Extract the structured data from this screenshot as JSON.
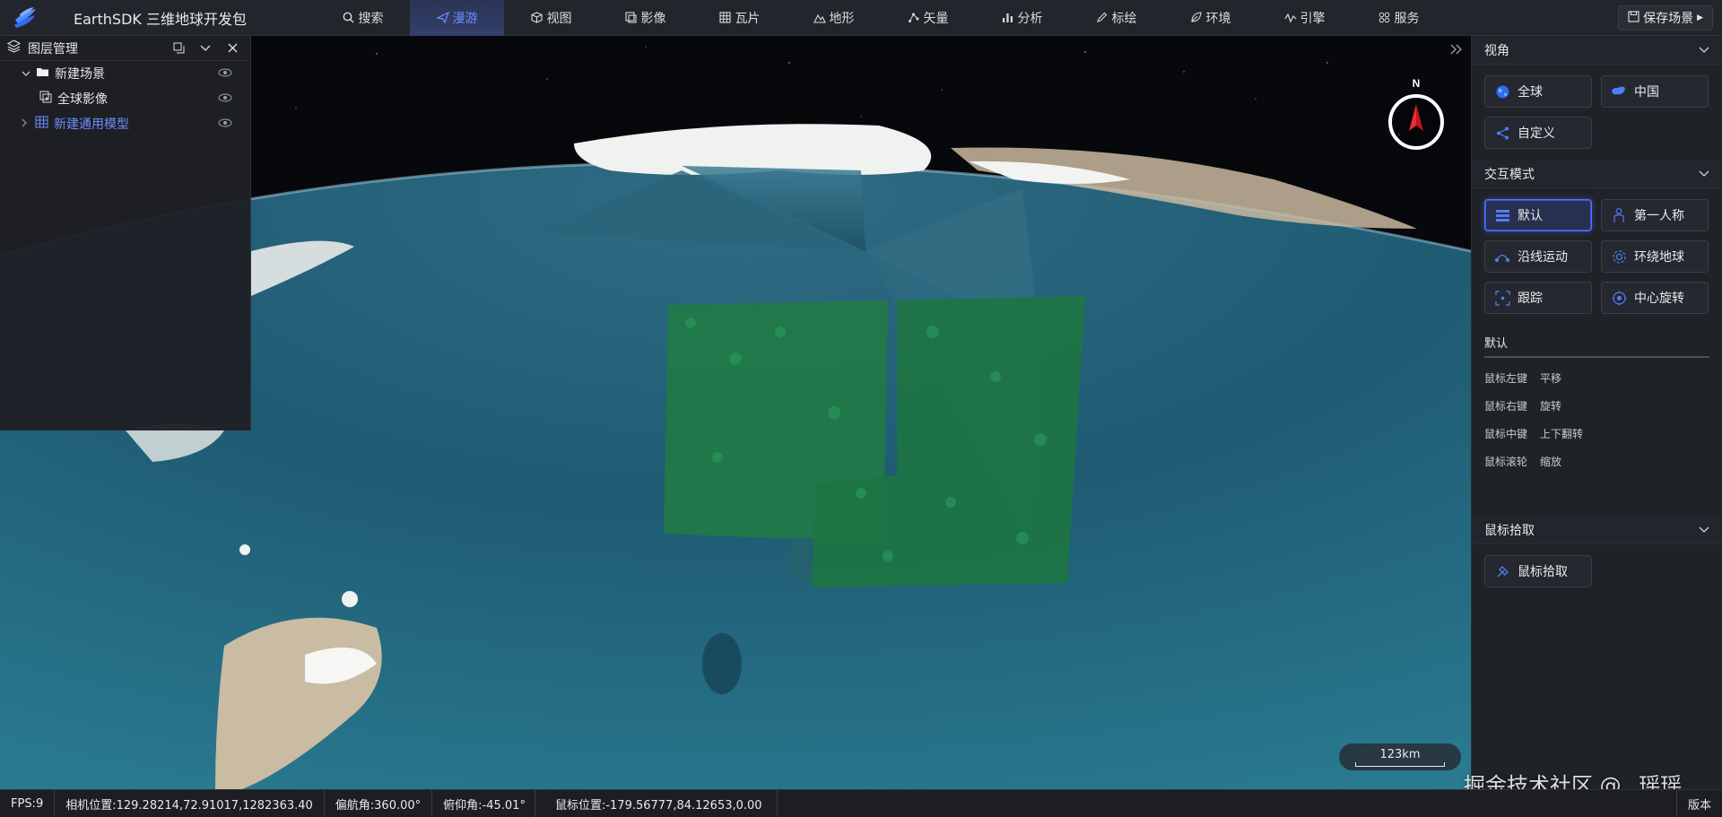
{
  "app": {
    "title": "EarthSDK 三维地球开发包"
  },
  "menu": [
    {
      "label": "搜索",
      "icon": "search-icon"
    },
    {
      "label": "漫游",
      "icon": "plane-icon",
      "active": true
    },
    {
      "label": "视图",
      "icon": "cube-icon"
    },
    {
      "label": "影像",
      "icon": "image-icon"
    },
    {
      "label": "瓦片",
      "icon": "tiles-icon"
    },
    {
      "label": "地形",
      "icon": "terrain-icon"
    },
    {
      "label": "矢量",
      "icon": "vector-icon"
    },
    {
      "label": "分析",
      "icon": "chart-icon"
    },
    {
      "label": "标绘",
      "icon": "pen-icon"
    },
    {
      "label": "环境",
      "icon": "leaf-icon"
    },
    {
      "label": "引擎",
      "icon": "engine-icon"
    },
    {
      "label": "服务",
      "icon": "grid-icon"
    }
  ],
  "save_scene_label": "保存场景",
  "layer_panel": {
    "title": "图层管理",
    "items": [
      {
        "label": "新建场景",
        "icon": "folder-icon"
      },
      {
        "label": "全球影像",
        "icon": "image-layer-icon"
      },
      {
        "label": "新建通用模型",
        "icon": "model-icon"
      }
    ]
  },
  "right_panel": {
    "view_section": {
      "title": "视角",
      "buttons": [
        {
          "label": "全球",
          "icon": "globe-icon"
        },
        {
          "label": "中国",
          "icon": "china-map-icon"
        },
        {
          "label": "自定义",
          "icon": "custom-view-icon"
        }
      ]
    },
    "interaction_section": {
      "title": "交互模式",
      "buttons": [
        {
          "label": "默认",
          "icon": "default-mode-icon",
          "active": true
        },
        {
          "label": "第一人称",
          "icon": "person-icon"
        },
        {
          "label": "沿线运动",
          "icon": "path-icon"
        },
        {
          "label": "环绕地球",
          "icon": "orbit-icon"
        },
        {
          "label": "跟踪",
          "icon": "track-icon"
        },
        {
          "label": "中心旋转",
          "icon": "rotate-icon"
        }
      ],
      "sub_title": "默认",
      "controls": [
        {
          "key": "鼠标左键",
          "value": "平移"
        },
        {
          "key": "鼠标右键",
          "value": "旋转"
        },
        {
          "key": "鼠标中键",
          "value": "上下翻转"
        },
        {
          "key": "鼠标滚轮",
          "value": "缩放"
        }
      ]
    },
    "pick_section": {
      "title": "鼠标拾取",
      "buttons": [
        {
          "label": "鼠标拾取",
          "icon": "pick-icon"
        }
      ]
    }
  },
  "compass": {
    "north_label": "N"
  },
  "scale": {
    "label": "123km"
  },
  "status": {
    "fps": "FPS:9",
    "camera": "相机位置:129.28214,72.91017,1282363.40",
    "heading": "偏航角:360.00°",
    "pitch": "俯仰角:-45.01°",
    "mouse": "鼠标位置:-179.56777,84.12653,0.00",
    "version": "版本"
  },
  "watermark": "掘金技术社区 @ _瑶瑶_",
  "colors": {
    "accent": "#5472ff",
    "ocean": "#2a6a80",
    "forest": "#1d7a45"
  }
}
